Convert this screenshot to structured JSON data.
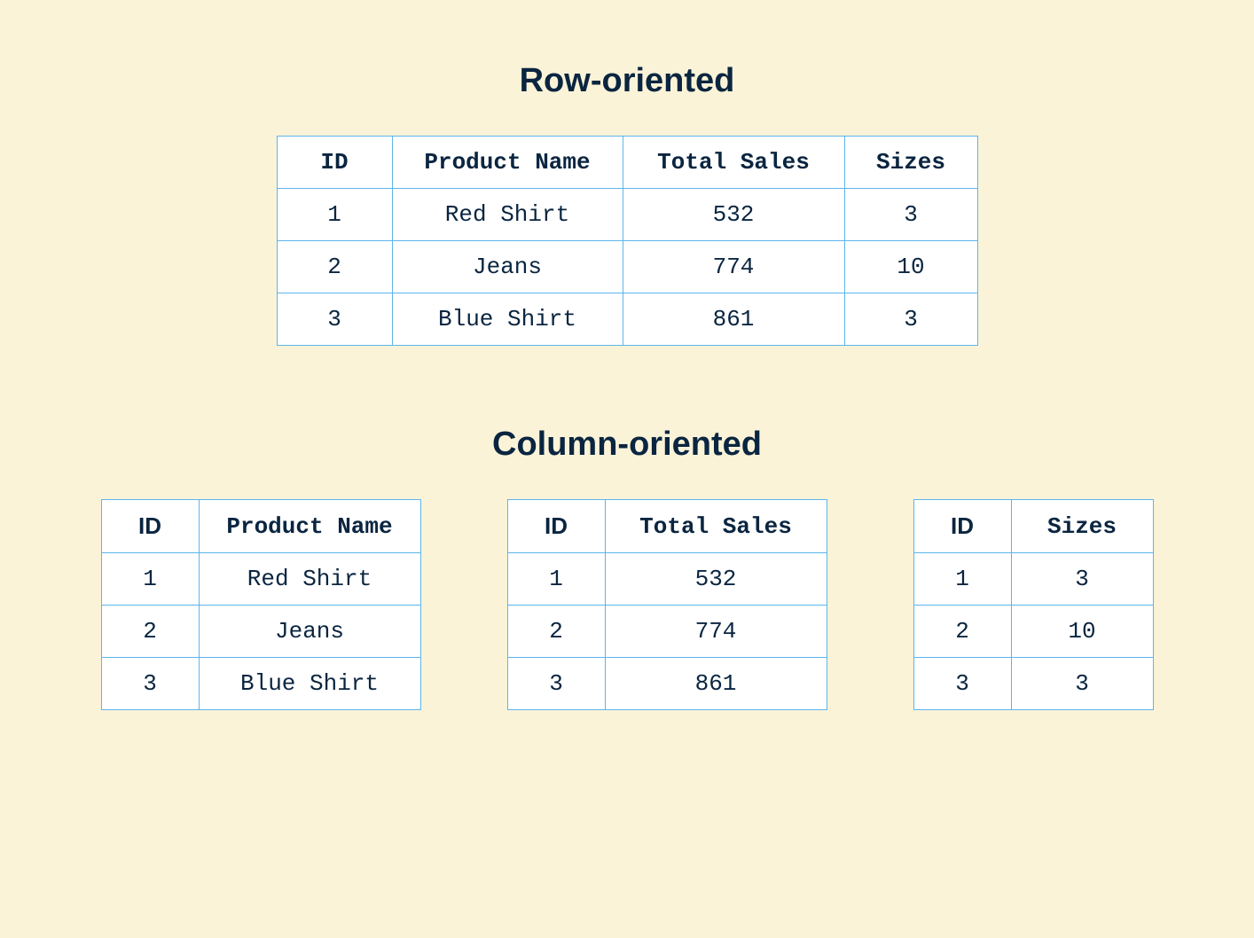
{
  "row_section": {
    "title": "Row-oriented",
    "headers": [
      "ID",
      "Product Name",
      "Total Sales",
      "Sizes"
    ],
    "rows": [
      [
        "1",
        "Red Shirt",
        "532",
        "3"
      ],
      [
        "2",
        "Jeans",
        "774",
        "10"
      ],
      [
        "3",
        "Blue Shirt",
        "861",
        "3"
      ]
    ]
  },
  "column_section": {
    "title": "Column-oriented",
    "tables": [
      {
        "headers": [
          "ID",
          "Product Name"
        ],
        "rows": [
          [
            "1",
            "Red Shirt"
          ],
          [
            "2",
            "Jeans"
          ],
          [
            "3",
            "Blue Shirt"
          ]
        ]
      },
      {
        "headers": [
          "ID",
          "Total Sales"
        ],
        "rows": [
          [
            "1",
            "532"
          ],
          [
            "2",
            "774"
          ],
          [
            "3",
            "861"
          ]
        ]
      },
      {
        "headers": [
          "ID",
          "Sizes"
        ],
        "rows": [
          [
            "1",
            "3"
          ],
          [
            "2",
            "10"
          ],
          [
            "3",
            "3"
          ]
        ]
      }
    ]
  },
  "chart_data": {
    "type": "table",
    "title_row": "Row-oriented",
    "title_column": "Column-oriented",
    "columns": [
      "ID",
      "Product Name",
      "Total Sales",
      "Sizes"
    ],
    "data": [
      {
        "ID": 1,
        "Product Name": "Red Shirt",
        "Total Sales": 532,
        "Sizes": 3
      },
      {
        "ID": 2,
        "Product Name": "Jeans",
        "Total Sales": 774,
        "Sizes": 10
      },
      {
        "ID": 3,
        "Product Name": "Blue Shirt",
        "Total Sales": 861,
        "Sizes": 3
      }
    ]
  }
}
